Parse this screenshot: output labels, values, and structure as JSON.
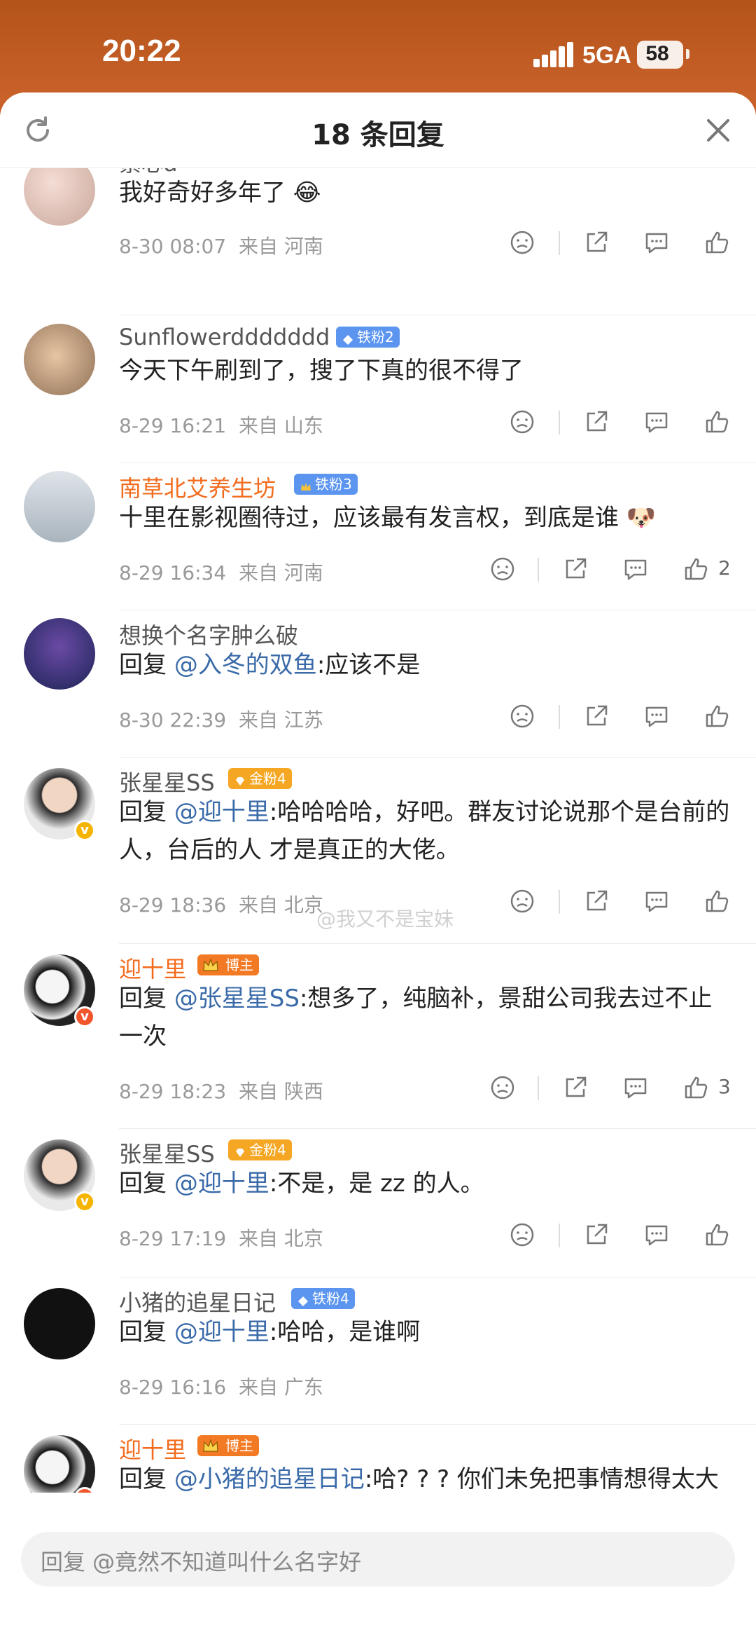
{
  "status_bar": {
    "time": "20:22",
    "network": "5GA",
    "battery": "58"
  },
  "header": {
    "title": "18 条回复"
  },
  "comments": [
    {
      "username": "紫心a",
      "text": "我好奇好多年了 😂",
      "date": "8-30 08:07",
      "location": "来自 河南",
      "likes": ""
    },
    {
      "username": "Sunflowerddddddd",
      "badge": "铁粉2",
      "text": "今天下午刷到了，搜了下真的很不得了",
      "date": "8-29 16:21",
      "location": "来自 山东",
      "likes": ""
    },
    {
      "username": "南草北艾养生坊",
      "badge": "铁粉3",
      "text": "十里在影视圈待过，应该最有发言权，到底是谁 🐶",
      "date": "8-29 16:34",
      "location": "来自 河南",
      "likes": "2"
    },
    {
      "username": "想换个名字肿么破",
      "reply_prefix": "回复",
      "mention": "@入冬的双鱼",
      "text": ":应该不是",
      "date": "8-30 22:39",
      "location": "来自 江苏",
      "likes": ""
    },
    {
      "username": "张星星SS",
      "badge": "金粉4",
      "reply_prefix": "回复",
      "mention": "@迎十里",
      "text": ":哈哈哈哈，好吧。群友讨论说那个是台前的人，台后的人 才是真正的大佬。",
      "date": "8-29 18:36",
      "location": "来自 北京",
      "likes": ""
    },
    {
      "username": "迎十里",
      "badge": "博主",
      "reply_prefix": "回复",
      "mention": "@张星星SS",
      "text": ":想多了，纯脑补，景甜公司我去过不止一次",
      "date": "8-29 18:23",
      "location": "来自 陕西",
      "likes": "3"
    },
    {
      "username": "张星星SS",
      "badge": "金粉4",
      "reply_prefix": "回复",
      "mention": "@迎十里",
      "text": ":不是，是 zz 的人。",
      "date": "8-29 17:19",
      "location": "来自 北京",
      "likes": ""
    },
    {
      "username": "小猪的追星日记",
      "badge": "铁粉4",
      "reply_prefix": "回复",
      "mention": "@迎十里",
      "text": ":哈哈，是谁啊",
      "date": "8-29 16:16",
      "location": "来自 广东",
      "likes": ""
    },
    {
      "username": "迎十里",
      "badge": "博主",
      "reply_prefix": "回复",
      "mention": "@小猪的追星日记",
      "text": ":哈? ? ? 你们未免把事情想得太大了",
      "date": "",
      "location": "",
      "likes": ""
    }
  ],
  "watermark": "@我又不是宝妹",
  "reply_bar": {
    "placeholder": "回复 @竟然不知道叫什么名字好"
  },
  "colors": {
    "accent": "#f36b1c",
    "mention": "#3a6aa8",
    "badge_blue": "#5b95f0",
    "badge_gold": "#f5a623"
  }
}
